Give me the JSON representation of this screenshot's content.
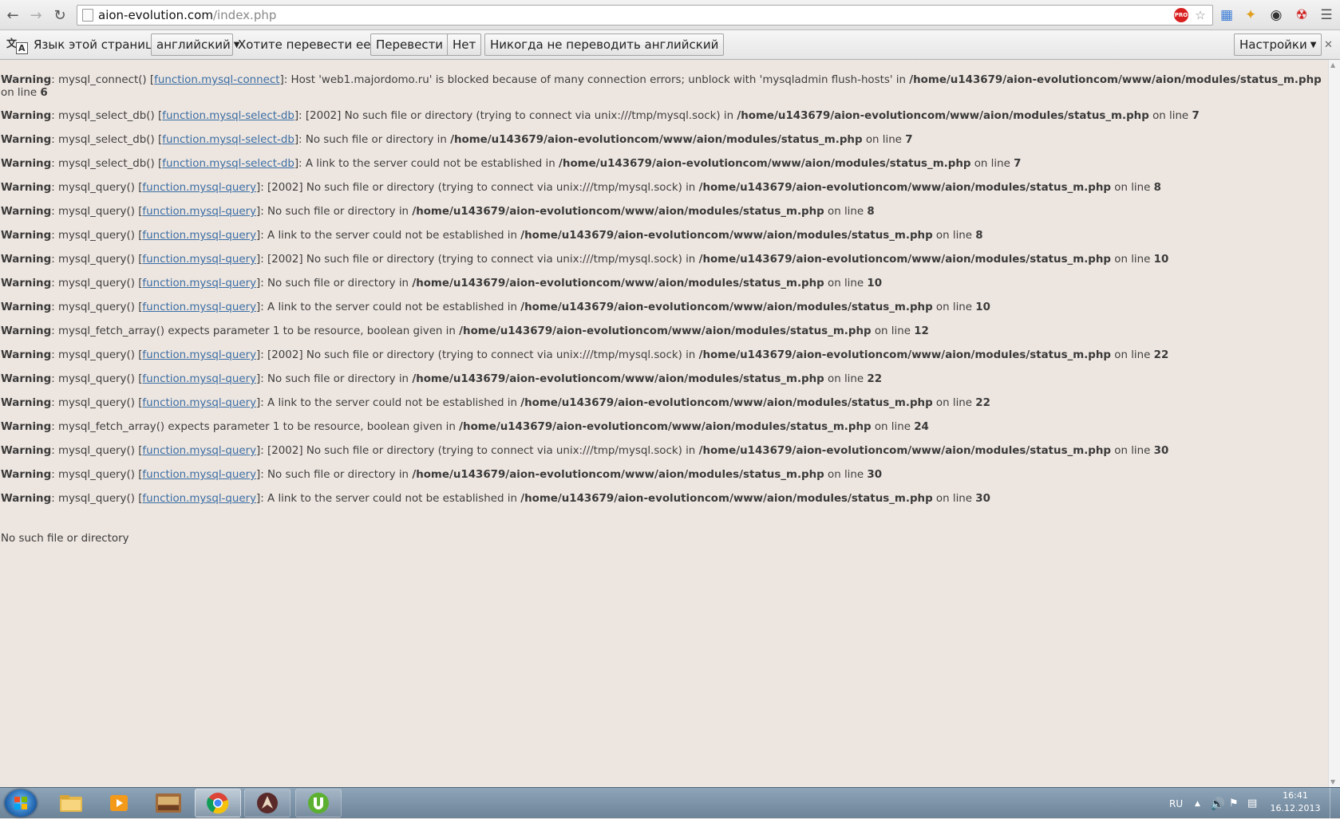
{
  "browser": {
    "url_host": "aion-evolution.com",
    "url_path": "/index.php",
    "pro_badge": "PRO"
  },
  "translate_bar": {
    "label": "Язык этой страницы",
    "language": "английский",
    "question": "Хотите перевести ее?",
    "translate_button": "Перевести",
    "no_button": "Нет",
    "never_button": "Никогда не переводить английский",
    "settings_button": "Настройки"
  },
  "warnings": [
    {
      "label": "Warning",
      "fn": "mysql_connect()",
      "link": "function.mysql-connect",
      "msg": "Host 'web1.majordomo.ru' is blocked because of many connection errors; unblock with 'mysqladmin flush-hosts' in",
      "path": "/home/u143679/aion-evolutioncom/www/aion/modules/status_m.php",
      "on": "on line",
      "line": "6"
    },
    {
      "label": "Warning",
      "fn": "mysql_select_db()",
      "link": "function.mysql-select-db",
      "msg": "[2002] No such file or directory (trying to connect via unix:///tmp/mysql.sock) in",
      "path": "/home/u143679/aion-evolutioncom/www/aion/modules/status_m.php",
      "on": "on line",
      "line": "7"
    },
    {
      "label": "Warning",
      "fn": "mysql_select_db()",
      "link": "function.mysql-select-db",
      "msg": "No such file or directory in",
      "path": "/home/u143679/aion-evolutioncom/www/aion/modules/status_m.php",
      "on": "on line",
      "line": "7"
    },
    {
      "label": "Warning",
      "fn": "mysql_select_db()",
      "link": "function.mysql-select-db",
      "msg": "A link to the server could not be established in",
      "path": "/home/u143679/aion-evolutioncom/www/aion/modules/status_m.php",
      "on": "on line",
      "line": "7"
    },
    {
      "label": "Warning",
      "fn": "mysql_query()",
      "link": "function.mysql-query",
      "msg": "[2002] No such file or directory (trying to connect via unix:///tmp/mysql.sock) in",
      "path": "/home/u143679/aion-evolutioncom/www/aion/modules/status_m.php",
      "on": "on line",
      "line": "8"
    },
    {
      "label": "Warning",
      "fn": "mysql_query()",
      "link": "function.mysql-query",
      "msg": "No such file or directory in",
      "path": "/home/u143679/aion-evolutioncom/www/aion/modules/status_m.php",
      "on": "on line",
      "line": "8"
    },
    {
      "label": "Warning",
      "fn": "mysql_query()",
      "link": "function.mysql-query",
      "msg": "A link to the server could not be established in",
      "path": "/home/u143679/aion-evolutioncom/www/aion/modules/status_m.php",
      "on": "on line",
      "line": "8"
    },
    {
      "label": "Warning",
      "fn": "mysql_query()",
      "link": "function.mysql-query",
      "msg": "[2002] No such file or directory (trying to connect via unix:///tmp/mysql.sock) in",
      "path": "/home/u143679/aion-evolutioncom/www/aion/modules/status_m.php",
      "on": "on line",
      "line": "10"
    },
    {
      "label": "Warning",
      "fn": "mysql_query()",
      "link": "function.mysql-query",
      "msg": "No such file or directory in",
      "path": "/home/u143679/aion-evolutioncom/www/aion/modules/status_m.php",
      "on": "on line",
      "line": "10"
    },
    {
      "label": "Warning",
      "fn": "mysql_query()",
      "link": "function.mysql-query",
      "msg": "A link to the server could not be established in",
      "path": "/home/u143679/aion-evolutioncom/www/aion/modules/status_m.php",
      "on": "on line",
      "line": "10"
    },
    {
      "label": "Warning",
      "fn": "mysql_fetch_array() expects parameter 1 to be resource, boolean given in",
      "link": "",
      "msg": "",
      "path": "/home/u143679/aion-evolutioncom/www/aion/modules/status_m.php",
      "on": "on line",
      "line": "12"
    },
    {
      "label": "Warning",
      "fn": "mysql_query()",
      "link": "function.mysql-query",
      "msg": "[2002] No such file or directory (trying to connect via unix:///tmp/mysql.sock) in",
      "path": "/home/u143679/aion-evolutioncom/www/aion/modules/status_m.php",
      "on": "on line",
      "line": "22"
    },
    {
      "label": "Warning",
      "fn": "mysql_query()",
      "link": "function.mysql-query",
      "msg": "No such file or directory in",
      "path": "/home/u143679/aion-evolutioncom/www/aion/modules/status_m.php",
      "on": "on line",
      "line": "22"
    },
    {
      "label": "Warning",
      "fn": "mysql_query()",
      "link": "function.mysql-query",
      "msg": "A link to the server could not be established in",
      "path": "/home/u143679/aion-evolutioncom/www/aion/modules/status_m.php",
      "on": "on line",
      "line": "22"
    },
    {
      "label": "Warning",
      "fn": "mysql_fetch_array() expects parameter 1 to be resource, boolean given in",
      "link": "",
      "msg": "",
      "path": "/home/u143679/aion-evolutioncom/www/aion/modules/status_m.php",
      "on": "on line",
      "line": "24"
    },
    {
      "label": "Warning",
      "fn": "mysql_query()",
      "link": "function.mysql-query",
      "msg": "[2002] No such file or directory (trying to connect via unix:///tmp/mysql.sock) in",
      "path": "/home/u143679/aion-evolutioncom/www/aion/modules/status_m.php",
      "on": "on line",
      "line": "30"
    },
    {
      "label": "Warning",
      "fn": "mysql_query()",
      "link": "function.mysql-query",
      "msg": "No such file or directory in",
      "path": "/home/u143679/aion-evolutioncom/www/aion/modules/status_m.php",
      "on": "on line",
      "line": "30"
    },
    {
      "label": "Warning",
      "fn": "mysql_query()",
      "link": "function.mysql-query",
      "msg": "A link to the server could not be established in",
      "path": "/home/u143679/aion-evolutioncom/www/aion/modules/status_m.php",
      "on": "on line",
      "line": "30"
    }
  ],
  "tail_text": "No such file or directory",
  "taskbar": {
    "language": "RU",
    "time": "16:41",
    "date": "16.12.2013"
  },
  "colors": {
    "page_bg": "#ede5df",
    "link": "#3a6ea5",
    "utorrent": "#5bb030",
    "chrome_red": "#db4437"
  }
}
